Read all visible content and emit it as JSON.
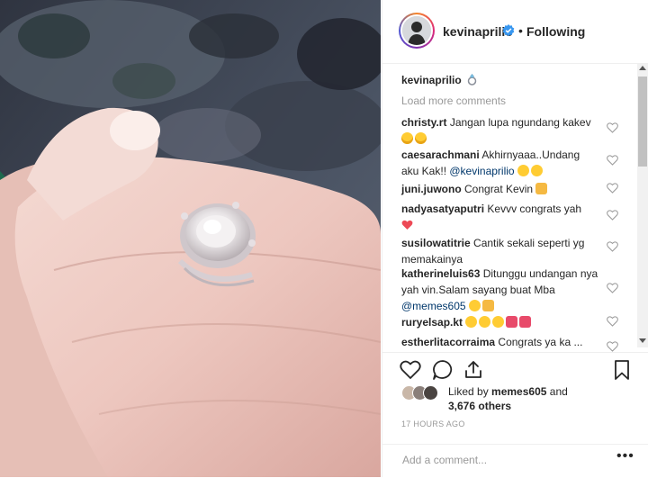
{
  "post": {
    "username": "kevinaprilio",
    "verified": true,
    "separator": "•",
    "follow_status": "Following",
    "photo_alt": "ring-on-hand-photo"
  },
  "caption": {
    "username": "kevinaprilio",
    "emoji_icon": "ring-icon"
  },
  "load_more": "Load more comments",
  "comments": [
    {
      "username": "christy.rt",
      "text": "Jangan lupa ngundang kakev",
      "emojis": [
        "grinning-icon",
        "grinning-icon"
      ]
    },
    {
      "username": "caesarachmani",
      "text": "Akhirnyaaa..Undang aku Kak!!",
      "mention": "@kevinaprilio",
      "emojis": [
        "star-eyes-icon",
        "star-eyes-icon"
      ]
    },
    {
      "username": "juni.juwono",
      "text": "Congrat Kevin",
      "emojis": [
        "pray-icon"
      ]
    },
    {
      "username": "nadyasatyaputri",
      "text": "Kevvv congrats yah",
      "emojis": [
        "heart-icon"
      ]
    },
    {
      "username": "susilowatitrie",
      "text": "Cantik sekali seperti yg memakainya",
      "emojis": []
    },
    {
      "username": "katherineluis63",
      "text": "Ditunggu undangan nya yah vin.Salam sayang buat Mba",
      "mention": "@memes605",
      "emojis": [
        "kiss-icon",
        "pray-icon"
      ]
    },
    {
      "username": "ruryelsap.kt",
      "text": "",
      "emojis": [
        "star-eyes-icon",
        "star-eyes-icon",
        "star-eyes-icon",
        "heart-eyes-cat-icon",
        "heart-eyes-cat-icon"
      ]
    },
    {
      "username": "estherlitacorraima",
      "text": "Congrats ya ka ...",
      "emojis": []
    }
  ],
  "actions": {
    "like_icon": "heart-outline-icon",
    "comment_icon": "comment-bubble-icon",
    "share_icon": "share-icon",
    "save_icon": "bookmark-icon"
  },
  "likes": {
    "prefix": "Liked by",
    "user": "memes605",
    "and": "and",
    "count": "3,676 others"
  },
  "timestamp": "17 HOURS AGO",
  "add_comment_placeholder": "Add a comment...",
  "more_label": "•••",
  "colors": {
    "verified_blue": "#3897f0",
    "muted": "#999999",
    "mention": "#00376b",
    "heart_red": "#ed4956"
  }
}
